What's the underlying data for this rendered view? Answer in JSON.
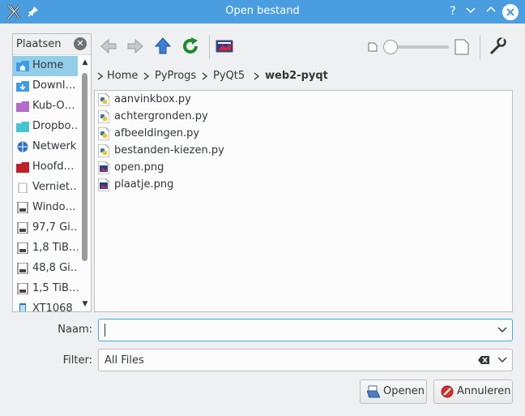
{
  "window": {
    "title": "Open bestand",
    "help_label": "?",
    "minimize_label": "⌄",
    "maximize_label": "⌃",
    "close_label": "✕"
  },
  "places": {
    "header": "Plaatsen",
    "items": [
      {
        "label": "Home",
        "icon": "home-folder-icon",
        "color": "#3d9be8",
        "selected": true
      },
      {
        "label": "Downl…",
        "icon": "downloads-folder-icon",
        "color": "#3d9be8"
      },
      {
        "label": "Kub-O…",
        "icon": "folder-icon",
        "color": "#b36cc9"
      },
      {
        "label": "Dropbo…",
        "icon": "folder-icon",
        "color": "#45c5d1"
      },
      {
        "label": "Netwerk",
        "icon": "network-icon",
        "color": "#2d6fc4"
      },
      {
        "label": "Hoofd…",
        "icon": "root-folder-icon",
        "color": "#c0202a"
      },
      {
        "label": "Verniet…",
        "icon": "trash-icon",
        "color": "#d8d8d8"
      },
      {
        "label": "Windo…",
        "icon": "drive-icon",
        "color": "#444"
      },
      {
        "label": "97,7 Gi…",
        "icon": "drive-icon",
        "color": "#444"
      },
      {
        "label": "1,8 TiB…",
        "icon": "drive-icon",
        "color": "#444"
      },
      {
        "label": "48,8 Gi…",
        "icon": "drive-icon",
        "color": "#444"
      },
      {
        "label": "1,5 TiB…",
        "icon": "drive-icon",
        "color": "#444"
      },
      {
        "label": "XT1068",
        "icon": "phone-icon",
        "color": "#2d6fc4"
      }
    ]
  },
  "breadcrumb": [
    "Home",
    "PyProgs",
    "PyQt5",
    "web2-pyqt"
  ],
  "files": [
    {
      "name": "aanvinkbox.py",
      "type": "python"
    },
    {
      "name": "achtergronden.py",
      "type": "python"
    },
    {
      "name": "afbeeldingen.py",
      "type": "python"
    },
    {
      "name": "bestanden-kiezen.py",
      "type": "python"
    },
    {
      "name": "open.png",
      "type": "image"
    },
    {
      "name": "plaatje.png",
      "type": "image"
    }
  ],
  "form": {
    "name_label": "Naam:",
    "name_value": "",
    "filter_label": "Filter:",
    "filter_value": "All Files"
  },
  "buttons": {
    "open": "Openen",
    "cancel": "Annuleren"
  },
  "colors": {
    "titlebar": "#4a9ee0",
    "selection": "#93cee9",
    "focus": "#3daee9"
  }
}
